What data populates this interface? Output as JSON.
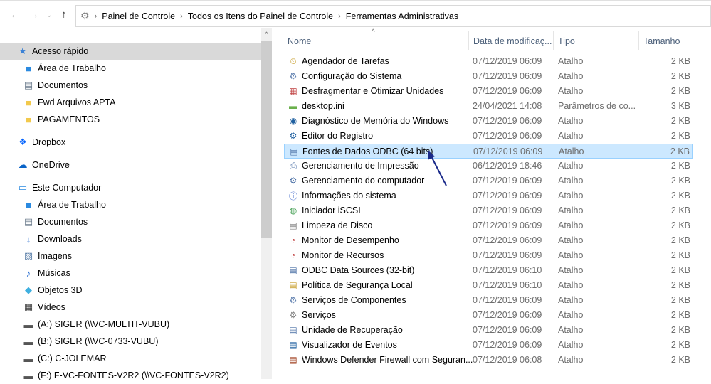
{
  "breadcrumb": [
    "Painel de Controle",
    "Todos os Itens do Painel de Controle",
    "Ferramentas Administrativas"
  ],
  "columns": {
    "name": "Nome",
    "date": "Data de modificaç...",
    "type": "Tipo",
    "size": "Tamanho"
  },
  "nav": [
    {
      "label": "Acesso rápido",
      "icon": "star-icon",
      "level": 0,
      "selected": true
    },
    {
      "label": "Área de Trabalho",
      "icon": "desktop-icon",
      "level": 1
    },
    {
      "label": "Documentos",
      "icon": "document-icon",
      "level": 1
    },
    {
      "label": "Fwd Arquivos APTA",
      "icon": "folder-icon",
      "level": 1
    },
    {
      "label": "PAGAMENTOS",
      "icon": "folder-sync-icon",
      "level": 1
    },
    {
      "label": "Dropbox",
      "icon": "dropbox-icon",
      "level": 0
    },
    {
      "label": "OneDrive",
      "icon": "cloud-icon",
      "level": 0
    },
    {
      "label": "Este Computador",
      "icon": "computer-icon",
      "level": 0
    },
    {
      "label": "Área de Trabalho",
      "icon": "desktop-icon",
      "level": 1
    },
    {
      "label": "Documentos",
      "icon": "document-icon",
      "level": 1
    },
    {
      "label": "Downloads",
      "icon": "download-icon",
      "level": 1
    },
    {
      "label": "Imagens",
      "icon": "image-icon",
      "level": 1
    },
    {
      "label": "Músicas",
      "icon": "music-icon",
      "level": 1
    },
    {
      "label": "Objetos 3D",
      "icon": "cube-icon",
      "level": 1
    },
    {
      "label": "Vídeos",
      "icon": "video-icon",
      "level": 1
    },
    {
      "label": "(A:) SIGER (\\\\VC-MULTIT-VUBU)",
      "icon": "network-drive-icon",
      "level": 1
    },
    {
      "label": "(B:) SIGER (\\\\VC-0733-VUBU)",
      "icon": "network-drive-icon",
      "level": 1
    },
    {
      "label": "(C:) C-JOLEMAR",
      "icon": "drive-icon",
      "level": 1
    },
    {
      "label": "(F:) F-VC-FONTES-V2R2 (\\\\VC-FONTES-V2R2)",
      "icon": "network-drive-icon",
      "level": 1
    }
  ],
  "files": [
    {
      "name": "Agendador de Tarefas",
      "date": "07/12/2019 06:09",
      "type": "Atalho",
      "size": "2 KB"
    },
    {
      "name": "Configuração do Sistema",
      "date": "07/12/2019 06:09",
      "type": "Atalho",
      "size": "2 KB"
    },
    {
      "name": "Desfragmentar e Otimizar Unidades",
      "date": "07/12/2019 06:09",
      "type": "Atalho",
      "size": "2 KB"
    },
    {
      "name": "desktop.ini",
      "date": "24/04/2021 14:08",
      "type": "Parâmetros de co...",
      "size": "3 KB"
    },
    {
      "name": "Diagnóstico de Memória do Windows",
      "date": "07/12/2019 06:09",
      "type": "Atalho",
      "size": "2 KB"
    },
    {
      "name": "Editor do Registro",
      "date": "07/12/2019 06:09",
      "type": "Atalho",
      "size": "2 KB"
    },
    {
      "name": "Fontes de Dados ODBC (64 bits)",
      "date": "07/12/2019 06:09",
      "type": "Atalho",
      "size": "2 KB",
      "selected": true
    },
    {
      "name": "Gerenciamento de Impressão",
      "date": "06/12/2019 18:46",
      "type": "Atalho",
      "size": "2 KB"
    },
    {
      "name": "Gerenciamento do computador",
      "date": "07/12/2019 06:09",
      "type": "Atalho",
      "size": "2 KB"
    },
    {
      "name": "Informações do sistema",
      "date": "07/12/2019 06:09",
      "type": "Atalho",
      "size": "2 KB"
    },
    {
      "name": "Iniciador iSCSI",
      "date": "07/12/2019 06:09",
      "type": "Atalho",
      "size": "2 KB"
    },
    {
      "name": "Limpeza de Disco",
      "date": "07/12/2019 06:09",
      "type": "Atalho",
      "size": "2 KB"
    },
    {
      "name": "Monitor de Desempenho",
      "date": "07/12/2019 06:09",
      "type": "Atalho",
      "size": "2 KB"
    },
    {
      "name": "Monitor de Recursos",
      "date": "07/12/2019 06:09",
      "type": "Atalho",
      "size": "2 KB"
    },
    {
      "name": "ODBC Data Sources (32-bit)",
      "date": "07/12/2019 06:10",
      "type": "Atalho",
      "size": "2 KB"
    },
    {
      "name": "Política de Segurança Local",
      "date": "07/12/2019 06:10",
      "type": "Atalho",
      "size": "2 KB"
    },
    {
      "name": "Serviços de Componentes",
      "date": "07/12/2019 06:09",
      "type": "Atalho",
      "size": "2 KB"
    },
    {
      "name": "Serviços",
      "date": "07/12/2019 06:09",
      "type": "Atalho",
      "size": "2 KB"
    },
    {
      "name": "Unidade de Recuperação",
      "date": "07/12/2019 06:09",
      "type": "Atalho",
      "size": "2 KB"
    },
    {
      "name": "Visualizador de Eventos",
      "date": "07/12/2019 06:09",
      "type": "Atalho",
      "size": "2 KB"
    },
    {
      "name": "Windows Defender Firewall com Seguran...",
      "date": "07/12/2019 06:08",
      "type": "Atalho",
      "size": "2 KB"
    }
  ]
}
